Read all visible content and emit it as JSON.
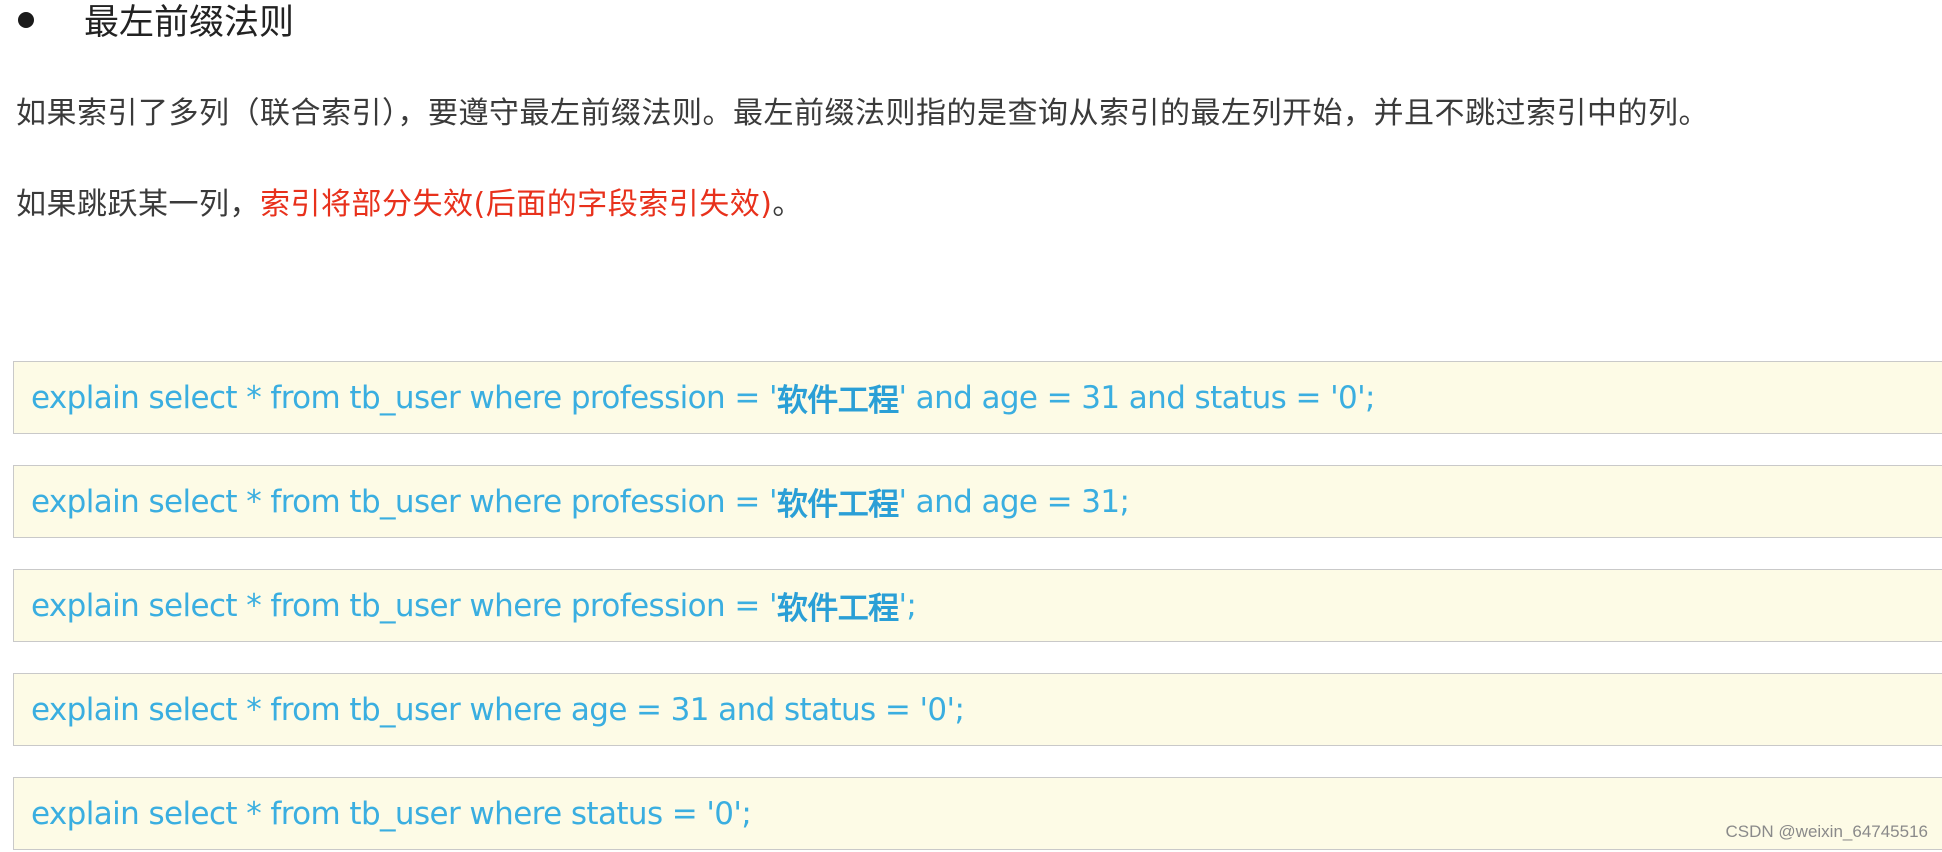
{
  "heading": {
    "text": "最左前缀法则"
  },
  "paragraphs": {
    "rule": "如果索引了多列（联合索引），要遵守最左前缀法则。最左前缀法则指的是查询从索引的最左列开始，并且不跳过索引中的列。",
    "skip_prefix": "如果跳跃某一列，",
    "skip_highlight": "索引将部分失效(后面的字段索引失效)",
    "skip_suffix": "。"
  },
  "code_lines": [
    {
      "pre": "explain select * from tb_user where profession = '",
      "cn": "软件工程",
      "post": "' and age = 31 and status = '0';"
    },
    {
      "pre": "explain select * from tb_user where profession = '",
      "cn": "软件工程",
      "post": "' and age = 31;"
    },
    {
      "pre": "explain select * from tb_user where profession = '",
      "cn": "软件工程",
      "post": "';"
    },
    {
      "pre": "explain select * from tb_user where age = 31 and status = '0';",
      "cn": "",
      "post": ""
    },
    {
      "pre": "explain select * from tb_user where status = '0';",
      "cn": "",
      "post": ""
    }
  ],
  "watermark": "CSDN @weixin_64745516",
  "colors": {
    "highlight_red": "#e8311c",
    "code_blue": "#3aaee0",
    "code_bg": "#fdfbe6"
  }
}
